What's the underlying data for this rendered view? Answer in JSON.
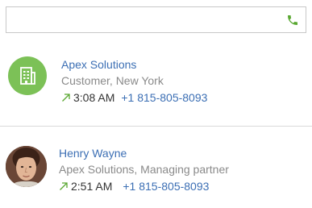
{
  "dialer": {
    "input_value": "",
    "input_placeholder": "",
    "call_icon": "phone-icon",
    "accent_color": "#5aa832"
  },
  "contacts": [
    {
      "name": "Apex Solutions",
      "subtitle": "Customer, New York",
      "avatar_icon": "building-icon",
      "avatar_color": "#7cc157",
      "call_direction_icon": "outgoing-arrow-icon",
      "call_time": "3:08 AM",
      "phone": "+1 815-805-8093"
    },
    {
      "name": "Henry Wayne",
      "subtitle": "Apex Solutions, Managing partner",
      "avatar_icon": "person-photo",
      "call_direction_icon": "outgoing-arrow-icon",
      "call_time": "2:51 AM",
      "phone": "+1 815-805-8093"
    }
  ],
  "colors": {
    "link": "#3c6fb4",
    "muted_text": "#8a8a8a",
    "outgoing_arrow": "#5aa832"
  }
}
